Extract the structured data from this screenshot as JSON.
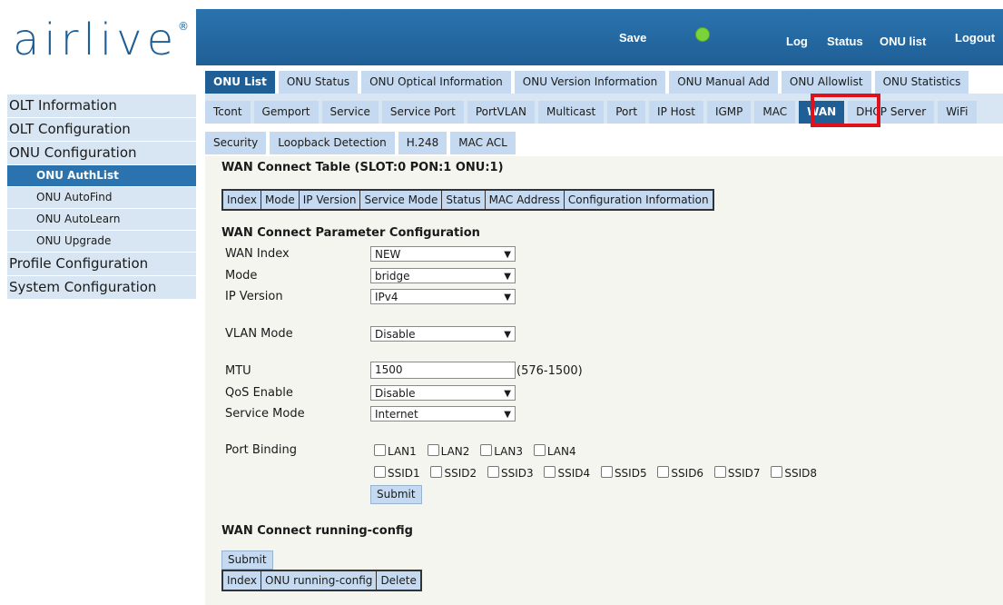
{
  "logo": {
    "text": "airlive",
    "mark": "®"
  },
  "header": {
    "save": "Save",
    "status_dot_color": "#7bd33a",
    "log": "Log",
    "status": "Status",
    "onu_list": "ONU list",
    "logout": "Logout"
  },
  "tabs_row1": [
    "ONU List",
    "ONU Status",
    "ONU Optical Information",
    "ONU Version Information",
    "ONU Manual Add",
    "ONU Allowlist",
    "ONU Statistics"
  ],
  "tabs_row2": [
    "Tcont",
    "Gemport",
    "Service",
    "Service Port",
    "PortVLAN",
    "Multicast",
    "Port",
    "IP Host",
    "IGMP",
    "MAC",
    "WAN",
    "DHCP Server",
    "WiFi"
  ],
  "tabs_row3": [
    "Security",
    "Loopback Detection",
    "H.248",
    "MAC ACL"
  ],
  "nav": {
    "olt_information": "OLT Information",
    "olt_configuration": "OLT Configuration",
    "onu_configuration": "ONU Configuration",
    "onu_authlist": "ONU AuthList",
    "onu_autofind": "ONU AutoFind",
    "onu_autolearn": "ONU AutoLearn",
    "onu_upgrade": "ONU Upgrade",
    "profile_configuration": "Profile Configuration",
    "system_configuration": "System Configuration"
  },
  "wan_table": {
    "title": "WAN Connect Table (SLOT:0 PON:1 ONU:1)",
    "columns": [
      "Index",
      "Mode",
      "IP Version",
      "Service Mode",
      "Status",
      "MAC Address",
      "Configuration Information"
    ]
  },
  "param": {
    "title": "WAN Connect Parameter Configuration",
    "wan_index_label": "WAN Index",
    "wan_index_value": "NEW",
    "mode_label": "Mode",
    "mode_value": "bridge",
    "ip_version_label": "IP Version",
    "ip_version_value": "IPv4",
    "vlan_mode_label": "VLAN Mode",
    "vlan_mode_value": "Disable",
    "mtu_label": "MTU",
    "mtu_value": "1500",
    "mtu_range": "(576-1500)",
    "qos_label": "QoS Enable",
    "qos_value": "Disable",
    "service_mode_label": "Service Mode",
    "service_mode_value": "Internet",
    "port_binding_label": "Port Binding",
    "lan_ports": [
      "LAN1",
      "LAN2",
      "LAN3",
      "LAN4"
    ],
    "ssid_ports": [
      "SSID1",
      "SSID2",
      "SSID3",
      "SSID4",
      "SSID5",
      "SSID6",
      "SSID7",
      "SSID8"
    ],
    "submit": "Submit"
  },
  "running": {
    "title": "WAN Connect running-config",
    "submit": "Submit",
    "columns": [
      "Index",
      "ONU running-config",
      "Delete"
    ]
  }
}
